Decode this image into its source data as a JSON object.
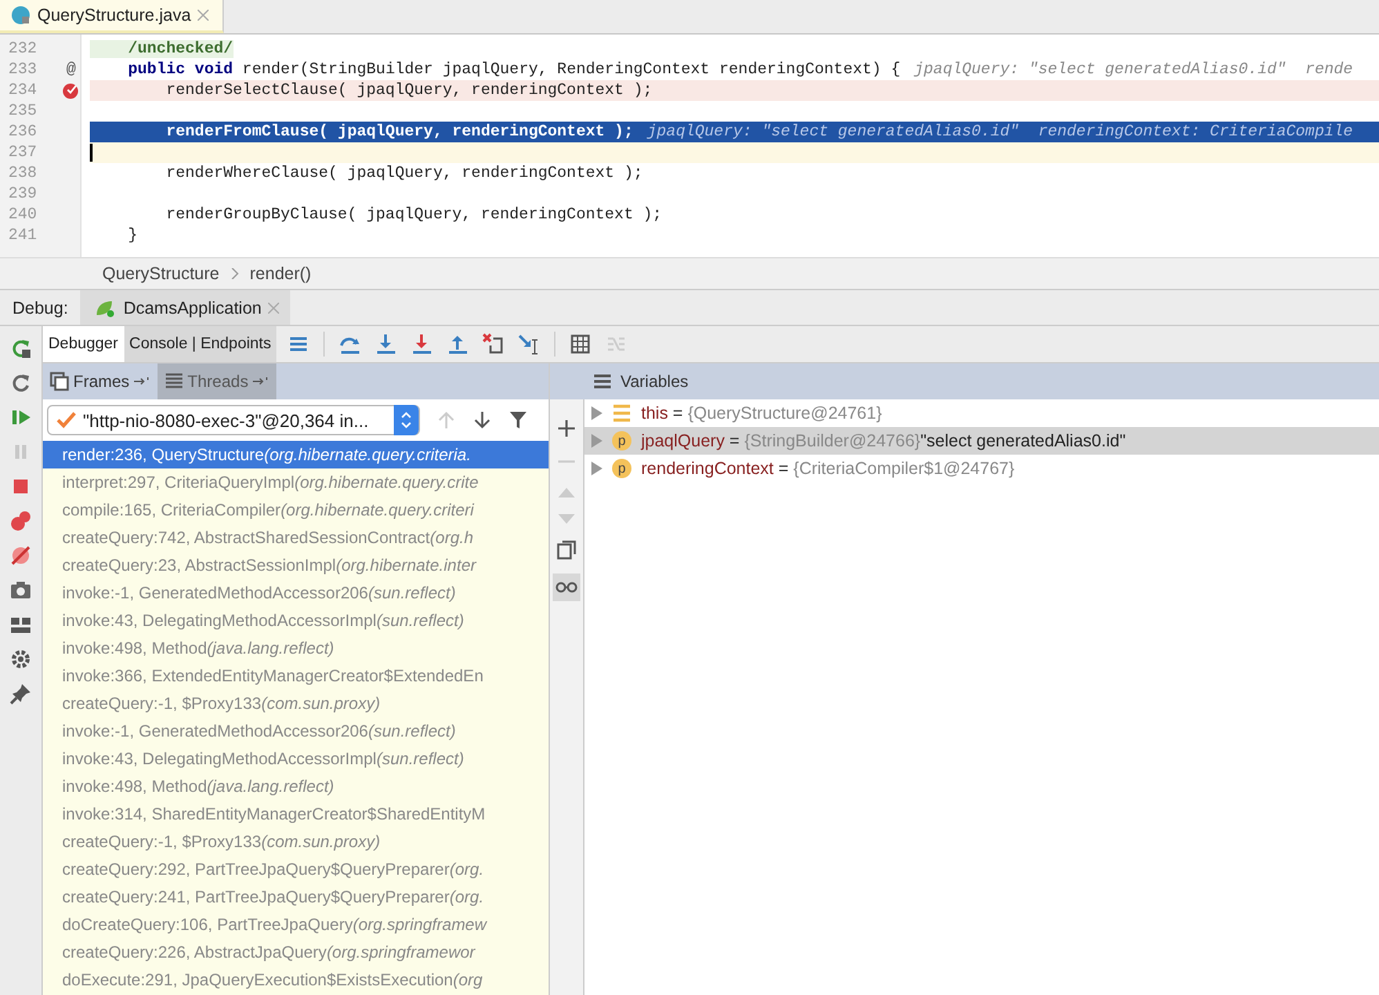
{
  "editor_tabs": [
    {
      "label": "QueryStructure.java",
      "selected": true
    }
  ],
  "editor": {
    "lines": [
      {
        "number": "232",
        "kind": "annotation",
        "code": "    /unchecked/"
      },
      {
        "number": "233",
        "kind": "normal",
        "gutter": "@",
        "code": "    **public void** render(StringBuilder jpaqlQuery, RenderingContext renderingContext) {",
        "hint": "jpaqlQuery: \"select generatedAlias0.id\"  rende"
      },
      {
        "number": "234",
        "kind": "breakpoint",
        "code": "        renderSelectClause( jpaqlQuery, renderingContext );"
      },
      {
        "number": "235",
        "kind": "normal"
      },
      {
        "number": "236",
        "kind": "execution",
        "code": "        renderFromClause( jpaqlQuery, renderingContext );",
        "hint": "jpaqlQuery: \"select generatedAlias0.id\"  renderingContext: CriteriaCompile"
      },
      {
        "number": "237",
        "kind": "caret"
      },
      {
        "number": "238",
        "kind": "normal",
        "code": "        renderWhereClause( jpaqlQuery, renderingContext );"
      },
      {
        "number": "239",
        "kind": "normal"
      },
      {
        "number": "240",
        "kind": "normal",
        "code": "        renderGroupByClause( jpaqlQuery, renderingContext );"
      },
      {
        "number": "241",
        "kind": "normal",
        "code": "    }"
      }
    ]
  },
  "breadcrumbs": [
    "QueryStructure",
    "render()"
  ],
  "debug_bar": {
    "label": "Debug:",
    "session": "DcamsApplication"
  },
  "debugger_tabs": [
    {
      "label": "Debugger",
      "selected": true
    },
    {
      "label": "Console | Endpoints",
      "selected": false
    }
  ],
  "frames_tabs": [
    {
      "label": "Frames",
      "selected": true
    },
    {
      "label": "Threads",
      "selected": false
    }
  ],
  "thread_selector": {
    "value": "\"http-nio-8080-exec-3\"@20,364 in..."
  },
  "frames": [
    {
      "method": "render:236, QueryStructure",
      "location": "(org.hibernate.query.criteria.",
      "selected": true
    },
    {
      "method": "interpret:297, CriteriaQueryImpl",
      "location": "(org.hibernate.query.crite",
      "selected": false
    },
    {
      "method": "compile:165, CriteriaCompiler",
      "location": "(org.hibernate.query.criteri",
      "selected": false
    },
    {
      "method": "createQuery:742, AbstractSharedSessionContract",
      "location": "(org.h",
      "selected": false
    },
    {
      "method": "createQuery:23, AbstractSessionImpl",
      "location": "(org.hibernate.inter",
      "selected": false
    },
    {
      "method": "invoke:-1, GeneratedMethodAccessor206",
      "location": "(sun.reflect)",
      "selected": false
    },
    {
      "method": "invoke:43, DelegatingMethodAccessorImpl",
      "location": "(sun.reflect)",
      "selected": false
    },
    {
      "method": "invoke:498, Method",
      "location": "(java.lang.reflect)",
      "selected": false
    },
    {
      "method": "invoke:366, ExtendedEntityManagerCreator$ExtendedEn",
      "selected": false
    },
    {
      "method": "createQuery:-1, $Proxy133",
      "location": "(com.sun.proxy)",
      "selected": false
    },
    {
      "method": "invoke:-1, GeneratedMethodAccessor206",
      "location": "(sun.reflect)",
      "selected": false
    },
    {
      "method": "invoke:43, DelegatingMethodAccessorImpl",
      "location": "(sun.reflect)",
      "selected": false
    },
    {
      "method": "invoke:498, Method",
      "location": "(java.lang.reflect)",
      "selected": false
    },
    {
      "method": "invoke:314, SharedEntityManagerCreator$SharedEntityM",
      "selected": false
    },
    {
      "method": "createQuery:-1, $Proxy133",
      "location": "(com.sun.proxy)",
      "selected": false
    },
    {
      "method": "createQuery:292, PartTreeJpaQuery$QueryPreparer",
      "location": "(org.",
      "selected": false
    },
    {
      "method": "createQuery:241, PartTreeJpaQuery$QueryPreparer",
      "location": "(org.",
      "selected": false
    },
    {
      "method": "doCreateQuery:106, PartTreeJpaQuery",
      "location": "(org.springframew",
      "selected": false
    },
    {
      "method": "createQuery:226, AbstractJpaQuery",
      "location": "(org.springframewor",
      "selected": false
    },
    {
      "method": "doExecute:291, JpaQueryExecution$ExistsExecution",
      "location": "(org",
      "selected": false
    }
  ],
  "variables_title": "Variables",
  "variables": [
    {
      "kind": "field",
      "name": "this",
      "equals": "=",
      "type": "{QueryStructure@24761}",
      "selected": false
    },
    {
      "kind": "param",
      "badge": "p",
      "name": "jpaqlQuery",
      "equals": "=",
      "type": "{StringBuilder@24766}",
      "value": "\"select generatedAlias0.id\"",
      "selected": true
    },
    {
      "kind": "param",
      "badge": "p",
      "name": "renderingContext",
      "equals": "=",
      "type": "{CriteriaCompiler$1@24767}",
      "selected": false
    }
  ]
}
